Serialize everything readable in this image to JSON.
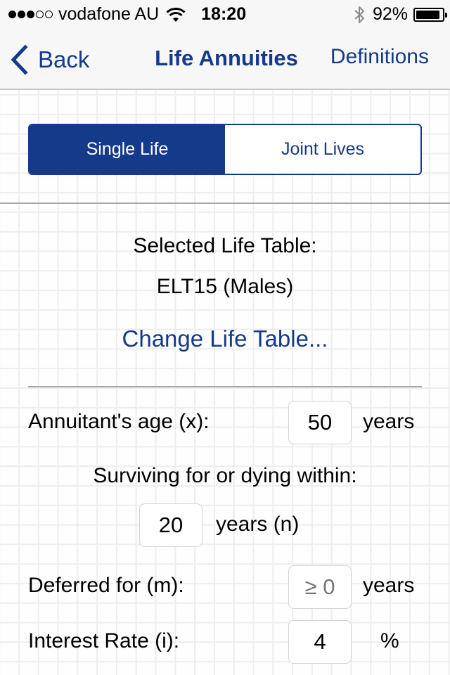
{
  "status_bar": {
    "signal_bars_filled": 3,
    "signal_bars_total": 5,
    "carrier": "vodafone AU",
    "time": "18:20",
    "battery_percent_label": "92%",
    "battery_level": 0.92,
    "icons": [
      "signal-dots-icon",
      "wifi-icon",
      "bluetooth-icon",
      "battery-icon"
    ]
  },
  "nav": {
    "back_label": "Back",
    "title": "Life Annuities",
    "right_label": "Definitions"
  },
  "segmented_control": {
    "options": [
      {
        "label": "Single Life",
        "selected": true
      },
      {
        "label": "Joint Lives",
        "selected": false
      }
    ]
  },
  "life_table": {
    "heading": "Selected Life Table:",
    "value": "ELT15 (Males)",
    "change_link": "Change Life Table..."
  },
  "form": {
    "age": {
      "label": "Annuitant's age (x):",
      "value": "50",
      "unit": "years"
    },
    "term_heading": "Surviving for or dying within:",
    "term": {
      "value": "20",
      "unit": "years (n)"
    },
    "deferred": {
      "label": "Deferred for (m):",
      "value": "",
      "placeholder": "≥ 0",
      "unit": "years"
    },
    "interest": {
      "label": "Interest Rate (i):",
      "value": "4",
      "unit": "%"
    }
  },
  "colors": {
    "accent": "#153a8a",
    "bar_background": "#f7f7f7",
    "divider": "#a9a9a9",
    "grid_line": "#eeeeee",
    "placeholder": "#c7c7cd"
  }
}
